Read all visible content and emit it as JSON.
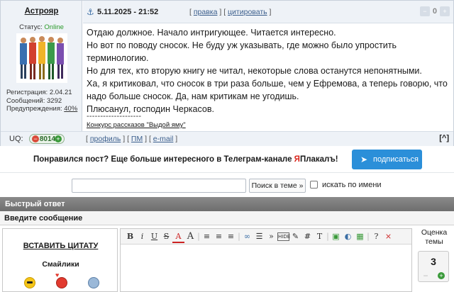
{
  "post": {
    "author": "Астрояр",
    "status_label": "Статус:",
    "status_value": "Online",
    "reg_line": "Регистрация: 2.04.21",
    "messages_line": "Сообщений: 3292",
    "warnings_label": "Предупреждения:",
    "warnings_value": "40%",
    "date": "5.11.2025 - 21:52",
    "action_edit": "правка",
    "action_quote": "цитировать",
    "votes": "0",
    "body": [
      "Отдаю должное. Начало интригующее. Читается интересно.",
      "Но вот по поводу сносок. Не буду уж указывать, где можно было упростить терминологию.",
      "Но для тех, кто вторую книгу не читал, некоторые слова останутся непонятными.",
      "Ха, я критиковал, что сносок в три раза больше, чем у Ефремова, а теперь говорю, что надо больше сносок. Да, нам критикам не угодишь.",
      "Плюсанул, господин Черкасов."
    ],
    "signature_separator": "--------------------",
    "signature_link": "Конкурс рассказов \"Выдой яму\"",
    "uq_label": "UQ:",
    "uq_value": "8014",
    "footer_profile": "профиль",
    "footer_pm": "ПМ",
    "footer_email": "e-mail",
    "up_label": "[^]"
  },
  "promo": {
    "text_before": "Понравился пост? Еще больше интересного в Телеграм-канале ",
    "brand_ya": "Я",
    "brand_rest": "Плакалъ!",
    "button": "подписаться"
  },
  "search": {
    "input_value": "",
    "button": "Поиск в теме »",
    "checkbox_label": "искать по имени"
  },
  "quick_reply": {
    "title": "Быстрый ответ",
    "enter_message": "Введите сообщение",
    "insert_quote": "ВСТАВИТЬ ЦИТАТУ",
    "smileys": "Смайлики",
    "rating_label": "Оценка темы",
    "rating_value": "3"
  },
  "toolbar_icons": [
    "bold-icon",
    "italic-icon",
    "underline-icon",
    "strikethrough-icon",
    "font-color-icon",
    "font-size-icon",
    "align-left-icon",
    "align-center-icon",
    "align-right-icon",
    "link-icon",
    "list-icon",
    "quote-icon",
    "hide-icon",
    "code-icon",
    "hash-icon",
    "text-icon",
    "image-icon",
    "spoiler-icon",
    "video-icon",
    "help-icon",
    "close-icon"
  ]
}
